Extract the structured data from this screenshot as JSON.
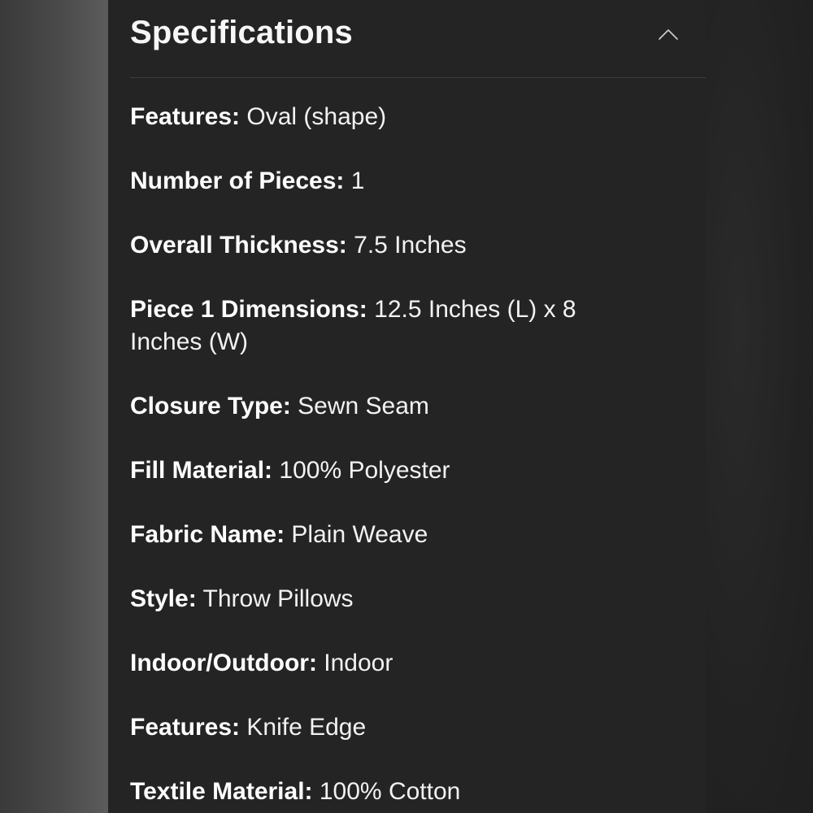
{
  "section": {
    "title": "Specifications",
    "collapse_icon": "chevron-up-icon"
  },
  "specs": [
    {
      "label": "Features:",
      "value": "Oval (shape)"
    },
    {
      "label": "Number of Pieces:",
      "value": "1"
    },
    {
      "label": "Overall Thickness:",
      "value": "7.5 Inches"
    },
    {
      "label": "Piece 1 Dimensions:",
      "value": "12.5 Inches (L) x 8 Inches (W)"
    },
    {
      "label": "Closure Type:",
      "value": "Sewn Seam"
    },
    {
      "label": "Fill Material:",
      "value": "100% Polyester"
    },
    {
      "label": "Fabric Name:",
      "value": "Plain Weave"
    },
    {
      "label": "Style:",
      "value": "Throw Pillows"
    },
    {
      "label": "Indoor/Outdoor:",
      "value": "Indoor"
    },
    {
      "label": "Features:",
      "value": "Knife Edge"
    },
    {
      "label": "Textile Material:",
      "value": "100% Cotton"
    }
  ],
  "colors": {
    "panel_background": "#242424",
    "page_background": "#1f1f1f",
    "text": "#f2f2f2",
    "divider": "#3b3b3b"
  }
}
